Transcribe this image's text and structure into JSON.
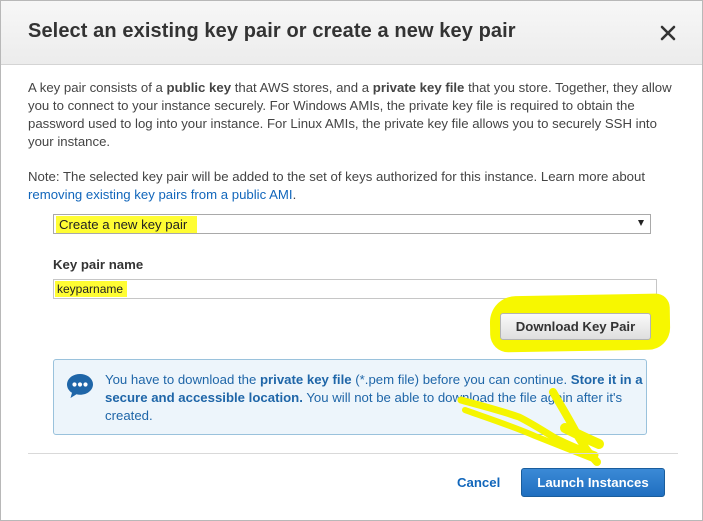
{
  "dialog": {
    "title": "Select an existing key pair or create a new key pair",
    "close_icon": "close-icon"
  },
  "description": {
    "p1": "A key pair consists of a ",
    "public_key": "public key",
    "p2": " that AWS stores, and a ",
    "private_key_file": "private key file",
    "p3": " that you store. Together, they allow you to connect to your instance securely. For Windows AMIs, the private key file is required to obtain the password used to log into your instance. For Linux AMIs, the private key file allows you to securely SSH into your instance."
  },
  "note": {
    "text": "Note: The selected key pair will be added to the set of keys authorized for this instance. Learn more about ",
    "link": "removing existing key pairs from a public AMI",
    "end": "."
  },
  "key_pair_select": {
    "selected": "Create a new key pair"
  },
  "key_pair_name": {
    "label": "Key pair name",
    "value": "keyparname"
  },
  "download_button": "Download Key Pair",
  "info_box": {
    "icon": "speech-bubble-icon",
    "t1": "You have to download the ",
    "b1": "private key file",
    "t2": " (*.pem file) before you can continue. ",
    "b2": "Store it in a secure and accessible location.",
    "t3": " You will not be able to download the file again after it's created."
  },
  "footer": {
    "cancel": "Cancel",
    "launch": "Launch Instances"
  },
  "colors": {
    "highlight": "#fffd33",
    "link": "#1166bb",
    "primary_button": "#1f6fc0",
    "info_background": "#edf5fb"
  }
}
